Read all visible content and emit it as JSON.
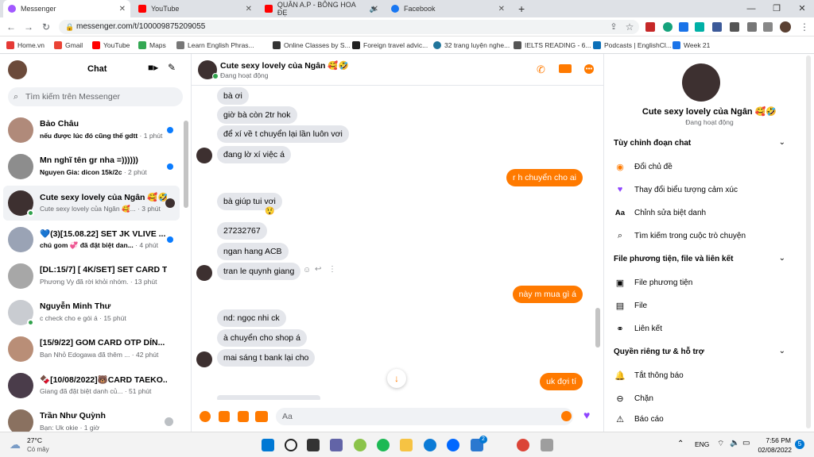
{
  "browser": {
    "tabs": [
      {
        "label": "Messenger",
        "active": true
      },
      {
        "label": "YouTube",
        "active": false
      },
      {
        "label": "QUÂN A.P - BÔNG HOA ĐẸ",
        "active": false
      },
      {
        "label": "Facebook",
        "active": false
      }
    ],
    "new_tab": "+",
    "url": "messenger.com/t/100009875209055",
    "bookmarks": [
      "Home.vn",
      "Gmail",
      "YouTube",
      "Maps",
      "Learn English Phras...",
      "Online Classes by S...",
      "Foreign travel advic...",
      "32 trang luyện nghe...",
      "IELTS READING - 6...",
      "Podcasts | EnglishCl...",
      "Week 21"
    ]
  },
  "sidebar": {
    "title": "Chat",
    "search_placeholder": "Tìm kiếm trên Messenger",
    "conversations": [
      {
        "name": "Bảo Châu",
        "preview": "nếu được lúc đó cũng thế gdtt",
        "time": "· 1 phút",
        "unread": true
      },
      {
        "name": "Mn nghĩ tên gr nha =))))))",
        "preview": "Nguyen Gia: dicon 15k/2c",
        "time": "· 2 phút",
        "unread": true
      },
      {
        "name": "Cute sexy lovely của Ngân 🥰🤣",
        "preview": "Cute sexy lovely của Ngân 🥰...",
        "time": "· 3 phút",
        "unread": false
      },
      {
        "name": "💙(3)[15.08.22] SET JK VLIVE ...",
        "preview": "chú gom 💞 đã đặt biệt dan...",
        "time": "· 4 phút",
        "unread": true
      },
      {
        "name": "[DL:15/7] [ 4K/SET] SET CARD T...",
        "preview": "Phương Vy đã rời khỏi nhóm.",
        "time": "· 13 phút",
        "unread": false
      },
      {
        "name": "Nguyễn Minh Thư",
        "preview": "c check cho e gói á",
        "time": "· 15 phút",
        "unread": false
      },
      {
        "name": "[15/9/22] GOM CARD OTP DÍN...",
        "preview": "Bạn Nhỏ Edogawa đã thêm ...",
        "time": "· 42 phút",
        "unread": false
      },
      {
        "name": "🍫[10/08/2022]🐻CARD TAEKO...",
        "preview": "Giang đã đặt biệt danh củ...",
        "time": "· 51 phút",
        "unread": false
      },
      {
        "name": "Trần Như Quỳnh",
        "preview": "Bạn: Uk okie",
        "time": "· 1 giờ",
        "unread": false
      }
    ]
  },
  "chat": {
    "name": "Cute sexy lovely của Ngân 🥰🤣",
    "status": "Đang hoạt động",
    "messages": [
      {
        "text": "bà ơi",
        "me": false
      },
      {
        "text": "giờ bà còn 2tr hok",
        "me": false
      },
      {
        "text": "để xí về t chuyển lại lần luôn vơi",
        "me": false
      },
      {
        "text": "đang lờ xí việc á",
        "me": false
      },
      {
        "text": "r h chuyển cho ai",
        "me": true
      },
      {
        "text": "bà giúp tui vơi",
        "me": false
      },
      {
        "text": "27232767",
        "me": false
      },
      {
        "text": "ngan hang ACB",
        "me": false
      },
      {
        "text": "tran le quynh giang",
        "me": false
      },
      {
        "text": "này m mua gì á",
        "me": true
      },
      {
        "text": "nd: ngọc nhi ck",
        "me": false
      },
      {
        "text": "à chuyển cho shop á",
        "me": false
      },
      {
        "text": "mai sáng t bank lại cho",
        "me": false
      },
      {
        "text": "uk đợi tí",
        "me": true
      }
    ],
    "reaction": "😲",
    "composer_placeholder": "Aa"
  },
  "info": {
    "name": "Cute sexy lovely của Ngân 🥰🤣",
    "status": "Đang hoạt động",
    "sections": [
      {
        "title": "Tùy chỉnh đoạn chat",
        "items": [
          {
            "label": "Đổi chủ đề",
            "icon": "theme-circle-icon"
          },
          {
            "label": "Thay đổi biểu tượng cảm xúc",
            "icon": "heart-icon"
          },
          {
            "label": "Chỉnh sửa biệt danh",
            "icon": "Aa"
          },
          {
            "label": "Tìm kiếm trong cuộc trò chuyện",
            "icon": "search-icon"
          }
        ]
      },
      {
        "title": "File phương tiện, file và liên kết",
        "items": [
          {
            "label": "File phương tiện",
            "icon": "media-icon"
          },
          {
            "label": "File",
            "icon": "file-icon"
          },
          {
            "label": "Liên kết",
            "icon": "link-icon"
          }
        ]
      },
      {
        "title": "Quyền riêng tư & hỗ trợ",
        "items": [
          {
            "label": "Tắt thông báo",
            "icon": "bell-icon"
          },
          {
            "label": "Chặn",
            "icon": "block-icon"
          },
          {
            "label": "Báo cáo",
            "icon": "warning-icon"
          }
        ]
      }
    ]
  },
  "taskbar": {
    "weather_temp": "27°C",
    "weather_desc": "Có mây",
    "lang": "ENG",
    "time": "7:56 PM",
    "date": "02/08/2022",
    "notif_badge": "5",
    "store_badge": "2"
  },
  "colors": {
    "accent": "#ff7a00",
    "unread": "#0a7cff",
    "online": "#31a24c"
  }
}
